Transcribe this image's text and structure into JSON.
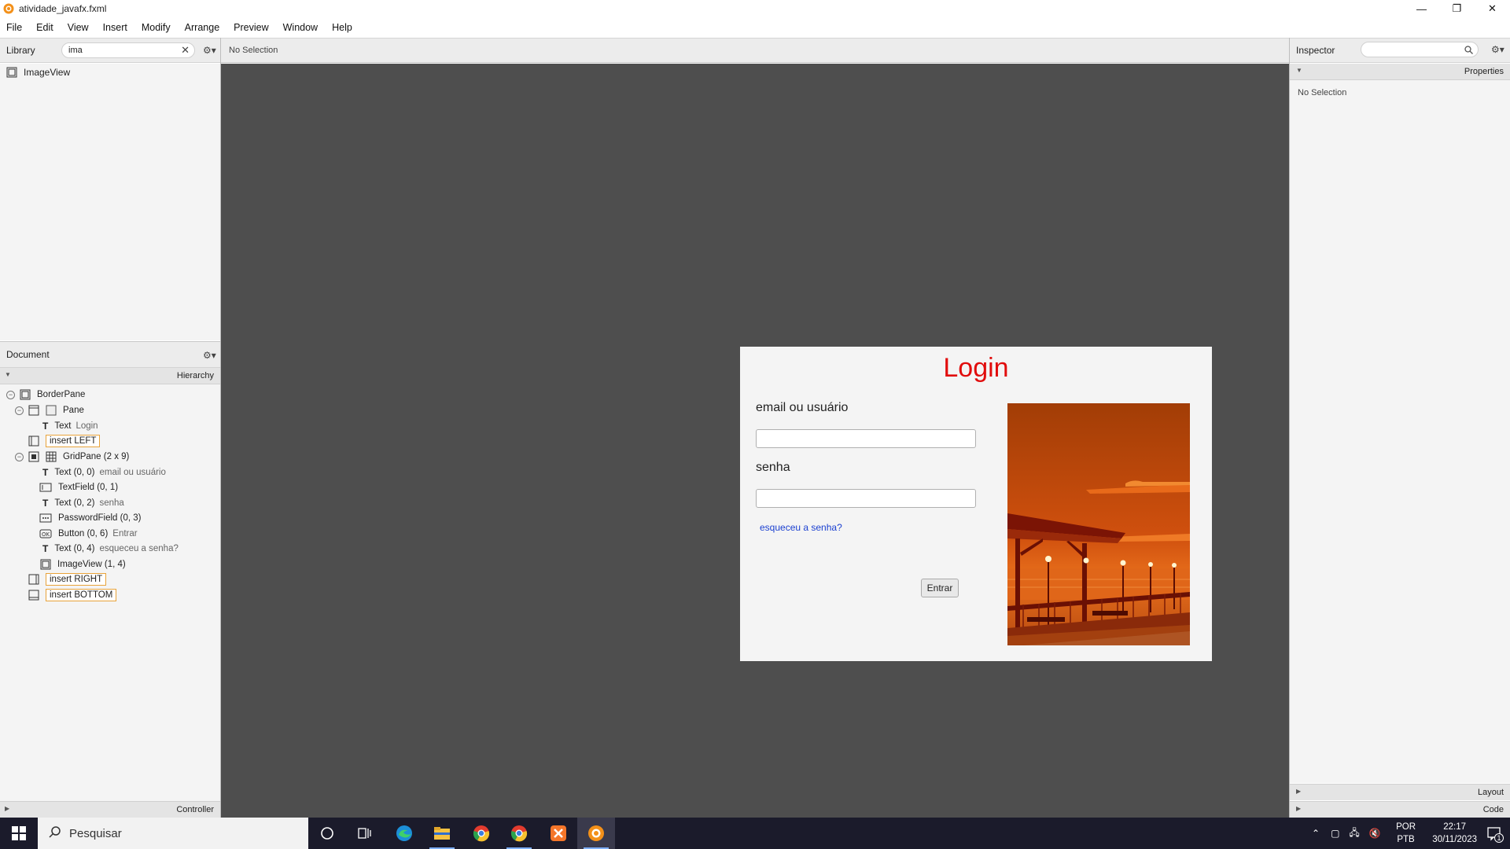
{
  "window": {
    "title": "atividade_javafx.fxml",
    "minimize": "—",
    "restore": "❐",
    "close": "✕"
  },
  "menu": [
    "File",
    "Edit",
    "View",
    "Insert",
    "Modify",
    "Arrange",
    "Preview",
    "Window",
    "Help"
  ],
  "library": {
    "label": "Library",
    "search_value": "ima",
    "results": [
      "ImageView"
    ]
  },
  "center": {
    "status": "No Selection"
  },
  "document": {
    "label": "Document",
    "hierarchy_label": "Hierarchy",
    "controller_label": "Controller",
    "tree": [
      {
        "label": "BorderPane",
        "sub": ""
      },
      {
        "label": "Pane",
        "sub": ""
      },
      {
        "label": "Text",
        "sub": "Login"
      },
      {
        "label": "insert LEFT",
        "sub": ""
      },
      {
        "label": "GridPane (2 x 9)",
        "sub": ""
      },
      {
        "label": "Text (0, 0)",
        "sub": "email ou usuário"
      },
      {
        "label": "TextField (0, 1)",
        "sub": ""
      },
      {
        "label": "Text (0, 2)",
        "sub": "senha"
      },
      {
        "label": "PasswordField (0, 3)",
        "sub": ""
      },
      {
        "label": "Button (0, 6)",
        "sub": "Entrar"
      },
      {
        "label": "Text (0, 4)",
        "sub": "esqueceu a senha?"
      },
      {
        "label": "ImageView (1, 4)",
        "sub": ""
      },
      {
        "label": "insert RIGHT",
        "sub": ""
      },
      {
        "label": "insert BOTTOM",
        "sub": ""
      }
    ]
  },
  "form": {
    "title": "Login",
    "email_label": "email ou usuário",
    "password_label": "senha",
    "forgot_link": "esqueceu a senha?",
    "submit": "Entrar"
  },
  "inspector": {
    "label": "Inspector",
    "properties_label": "Properties",
    "no_selection": "No Selection",
    "layout_label": "Layout",
    "code_label": "Code"
  },
  "taskbar": {
    "search_placeholder": "Pesquisar",
    "lang_top": "POR",
    "lang_bottom": "PTB",
    "time": "22:17",
    "date": "30/11/2023",
    "notif_count": "1"
  },
  "colors": {
    "accent_title": "#e10d0d",
    "link": "#1a3fd0",
    "canvas": "#4e4e4e",
    "insert_border": "#e8a33a"
  }
}
